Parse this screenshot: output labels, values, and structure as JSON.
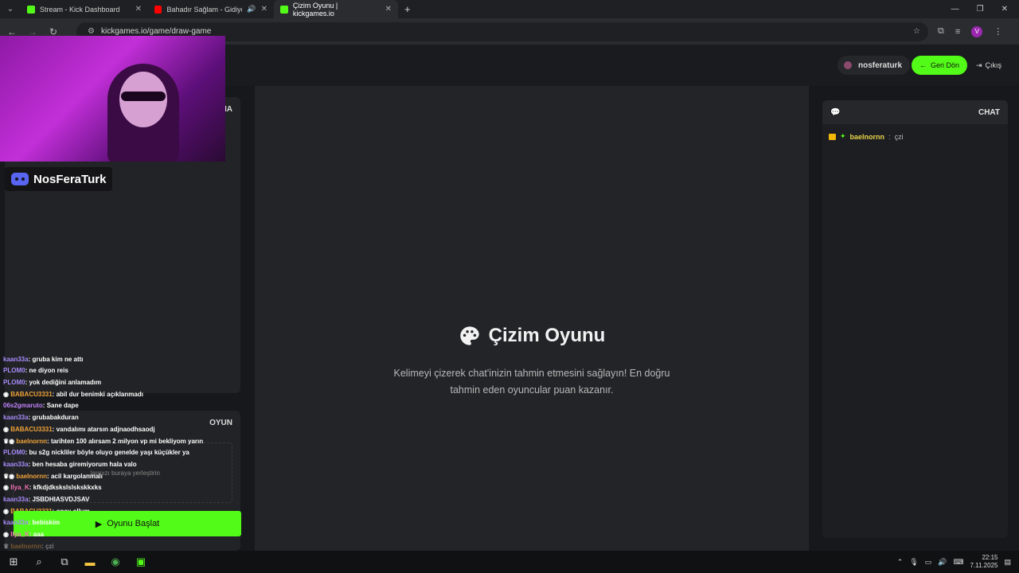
{
  "browser": {
    "tabs": [
      {
        "title": "Stream - Kick Dashboard",
        "color": "#53fc18"
      },
      {
        "title": "Bahadır Sağlam - Gidiyor G",
        "color": "#ff0000"
      },
      {
        "title": "Çizim Oyunu | kickgames.io",
        "color": "#53fc18"
      }
    ],
    "url": "kickgames.io/game/draw-game",
    "profile_initial": "V"
  },
  "header": {
    "username": "nosferaturk",
    "back_label": "Geri Dön",
    "exit_label": "Çıkış"
  },
  "left": {
    "panel1_title": "MA",
    "panel2_title": "OYUN",
    "drop_hint": "...larınızı buraya yerleştirin",
    "start_label": "Oyunu Başlat"
  },
  "center": {
    "title": "Çizim Oyunu",
    "description": "Kelimeyi çizerek chat'inizin tahmin etmesini sağlayın! En doğru tahmin eden oyuncular puan kazanır."
  },
  "chat": {
    "title": "CHAT",
    "messages": [
      {
        "user": "baelnornn",
        "sep": ":",
        "text": "çzi"
      }
    ]
  },
  "overlay": {
    "streamer_tag": "NosFeraTurk",
    "stream_chat": [
      {
        "user": "kaan33a",
        "text": "gruba kim ne attı"
      },
      {
        "user": "PLOM0",
        "text": "ne diyon reis"
      },
      {
        "user": "PLOM0",
        "text": "yok dediğini anlamadım"
      },
      {
        "user": "BABACU3331",
        "text": "abil dur benimki açıklanmadı"
      },
      {
        "user": "06s2gmaruto",
        "text": "Sane dape"
      },
      {
        "user": "kaan33a",
        "text": "grubabakduran"
      },
      {
        "user": "BABACU3331",
        "text": "vandalımı atarsın adjnaodhsaodj"
      },
      {
        "user": "baelnornn",
        "text": "tarihten 100 alırsam 2 milyon vp mi bekliyom yarın"
      },
      {
        "user": "PLOM0",
        "text": "bu s2g nickliler böyle oluyo genelde yaşı küçükler ya"
      },
      {
        "user": "kaan33a",
        "text": "ben hesaba giremiyorum hala valo"
      },
      {
        "user": "baelnornn",
        "text": "acil kargolanmalı"
      },
      {
        "user": "Ilya_K",
        "text": "kfkdjdkskslslskskkxks"
      },
      {
        "user": "kaan33a",
        "text": "JSBDHIASVDJSAV"
      },
      {
        "user": "BABACU3331",
        "text": "oney ollum"
      },
      {
        "user": "kaan33a",
        "text": "bebiskim"
      },
      {
        "user": "Ilya_K",
        "text": "aaa"
      },
      {
        "user": "baelnornn",
        "text": "çzi"
      }
    ]
  },
  "taskbar": {
    "time": "22:15",
    "date": "7.11.2025"
  }
}
